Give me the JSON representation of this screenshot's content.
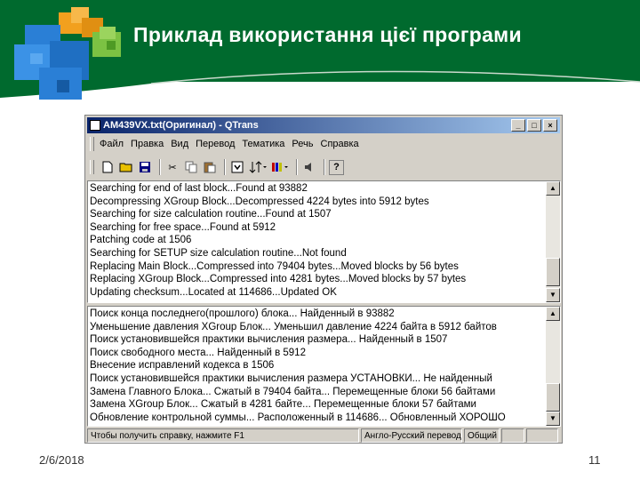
{
  "slide": {
    "title": "Приклад використання цієї програми",
    "date": "2/6/2018",
    "page_number": "11",
    "colors": {
      "header": "#006a2e",
      "logo_blue": "#2a7fd6",
      "logo_orange": "#f2a01e",
      "logo_green": "#7cc243"
    }
  },
  "window": {
    "title": "AM439VX.txt(Оригинал) - QTrans",
    "menu": [
      "Файл",
      "Правка",
      "Вид",
      "Перевод",
      "Тематика",
      "Речь",
      "Справка"
    ],
    "toolbar_icons": [
      "new-document-icon",
      "open-folder-icon",
      "save-icon",
      "cut-icon",
      "copy-icon",
      "paste-icon",
      "translate-block-icon",
      "sort-icon",
      "colors-icon",
      "speaker-icon",
      "help-icon"
    ],
    "source_lines": [
      "Searching for end of last block...Found at 93882",
      "Decompressing XGroup Block...Decompressed 4224 bytes into 5912 bytes",
      "Searching for size calculation routine...Found at 1507",
      "Searching for free space...Found at 5912",
      "Patching code at 1506",
      "Searching for SETUP size calculation routine...Not found",
      "Replacing Main Block...Compressed into 79404 bytes...Moved blocks by 56 bytes",
      "Replacing XGroup Block...Compressed into 4281 bytes...Moved blocks by 57 bytes",
      "Updating checksum...Located at 114686...Updated OK"
    ],
    "translated_lines": [
      "Поиск конца последнего(прошлого) блока... Найденный в 93882",
      "Уменьшение давления XGroup Блок... Уменьшил давление 4224 байта в 5912 байтов",
      "Поиск установившейся практики вычисления размера... Найденный в 1507",
      "Поиск свободного места... Найденный в 5912",
      "Внесение исправлений кодекса в 1506",
      "Поиск установившейся практики вычисления размера УСТАНОВКИ... Не найденный",
      "Замена Главного Блока... Сжатый в 79404 байта... Перемещенные блоки 56 байтами",
      "Замена XGroup Блок... Сжатый в 4281 байте... Перемещенные блоки 57 байтами",
      "Обновление контрольной суммы... Расположенный в 114686... Обновленный ХОРОШО"
    ],
    "status": {
      "hint": "Чтобы получить справку, нажмите F1",
      "direction": "Англо-Русский перевод",
      "topic": "Общий"
    }
  }
}
